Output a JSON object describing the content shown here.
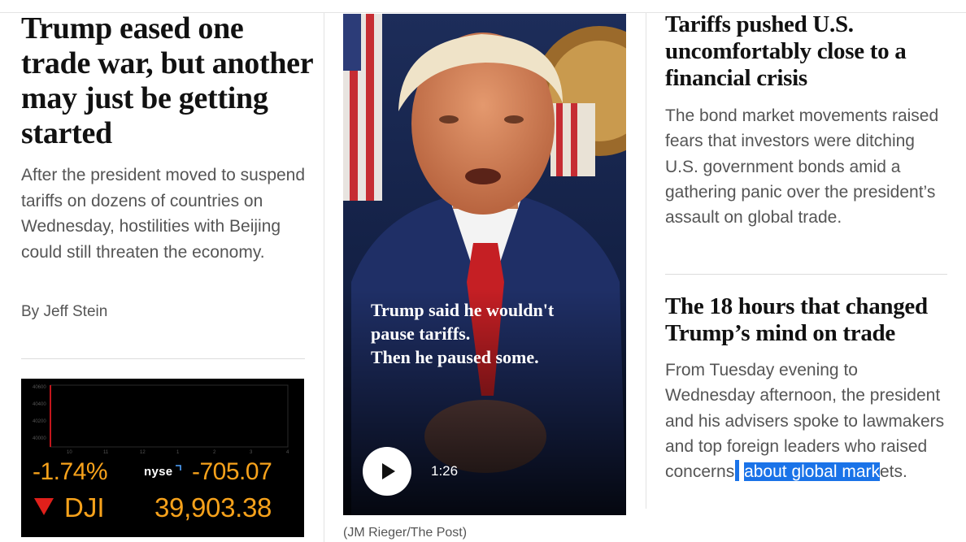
{
  "main_story": {
    "headline": "Trump eased one trade war, but another may just be getting started",
    "blurb": "After the president moved to suspend tariffs on dozens of countries on Wednesday, hostilities with Beijing could still threaten the economy.",
    "byline": "By Jeff Stein"
  },
  "ticker": {
    "percent_change": "-1.74%",
    "exchange_logo": "NYSE",
    "points_change": "-705.07",
    "symbol": "DJI",
    "price": "39,903.38",
    "y_ticks": [
      "40600",
      "40400",
      "40200",
      "40000"
    ],
    "x_ticks": [
      "10",
      "11",
      "12",
      "1",
      "2",
      "3",
      "4"
    ],
    "accent_color": "#f7a21b",
    "down_color": "#e0201b"
  },
  "video": {
    "caption_lines": [
      "Trump said he wouldn't",
      "pause tariffs.",
      "Then he paused some."
    ],
    "duration": "1:26",
    "play_icon": "play-icon",
    "credit": "(JM Rieger/The Post)"
  },
  "story_2": {
    "headline": "Tariffs pushed U.S. uncomfortably close to a financial crisis",
    "blurb": "The bond market movements raised fears that investors were ditching U.S. government bonds amid a gathering panic over the president’s assault on global trade."
  },
  "story_3": {
    "headline": "The 18 hours that changed Trump’s mind on trade",
    "blurb_before_selection": "From Tuesday evening to Wednesday afternoon, the president and his advisers spoke to lawmakers and top foreign leaders who raised concerns",
    "blurb_selected": "about global mark",
    "blurb_after_selection": "ets.",
    "selection_color": "#1a73e8"
  }
}
